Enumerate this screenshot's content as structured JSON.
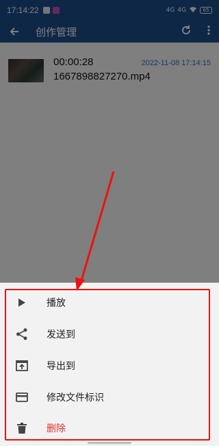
{
  "status_bar": {
    "time": "17:14:22",
    "signal_1": "4G",
    "signal_2": "4G",
    "battery": "65"
  },
  "app_bar": {
    "title": "创作管理"
  },
  "list": {
    "items": [
      {
        "duration": "00:00:28",
        "date": "2022-11-08 17:14:15",
        "filename": "1667898827270.mp4"
      }
    ]
  },
  "menu": {
    "items": [
      {
        "label": "播放",
        "icon": "play-icon"
      },
      {
        "label": "发送到",
        "icon": "share-icon"
      },
      {
        "label": "导出到",
        "icon": "export-icon"
      },
      {
        "label": "修改文件标识",
        "icon": "card-icon"
      },
      {
        "label": "删除",
        "icon": "trash-icon"
      }
    ]
  },
  "colors": {
    "header": "#1f4e8e",
    "accent_date": "#2a7ac0",
    "danger": "#d33",
    "highlight": "#e11"
  }
}
